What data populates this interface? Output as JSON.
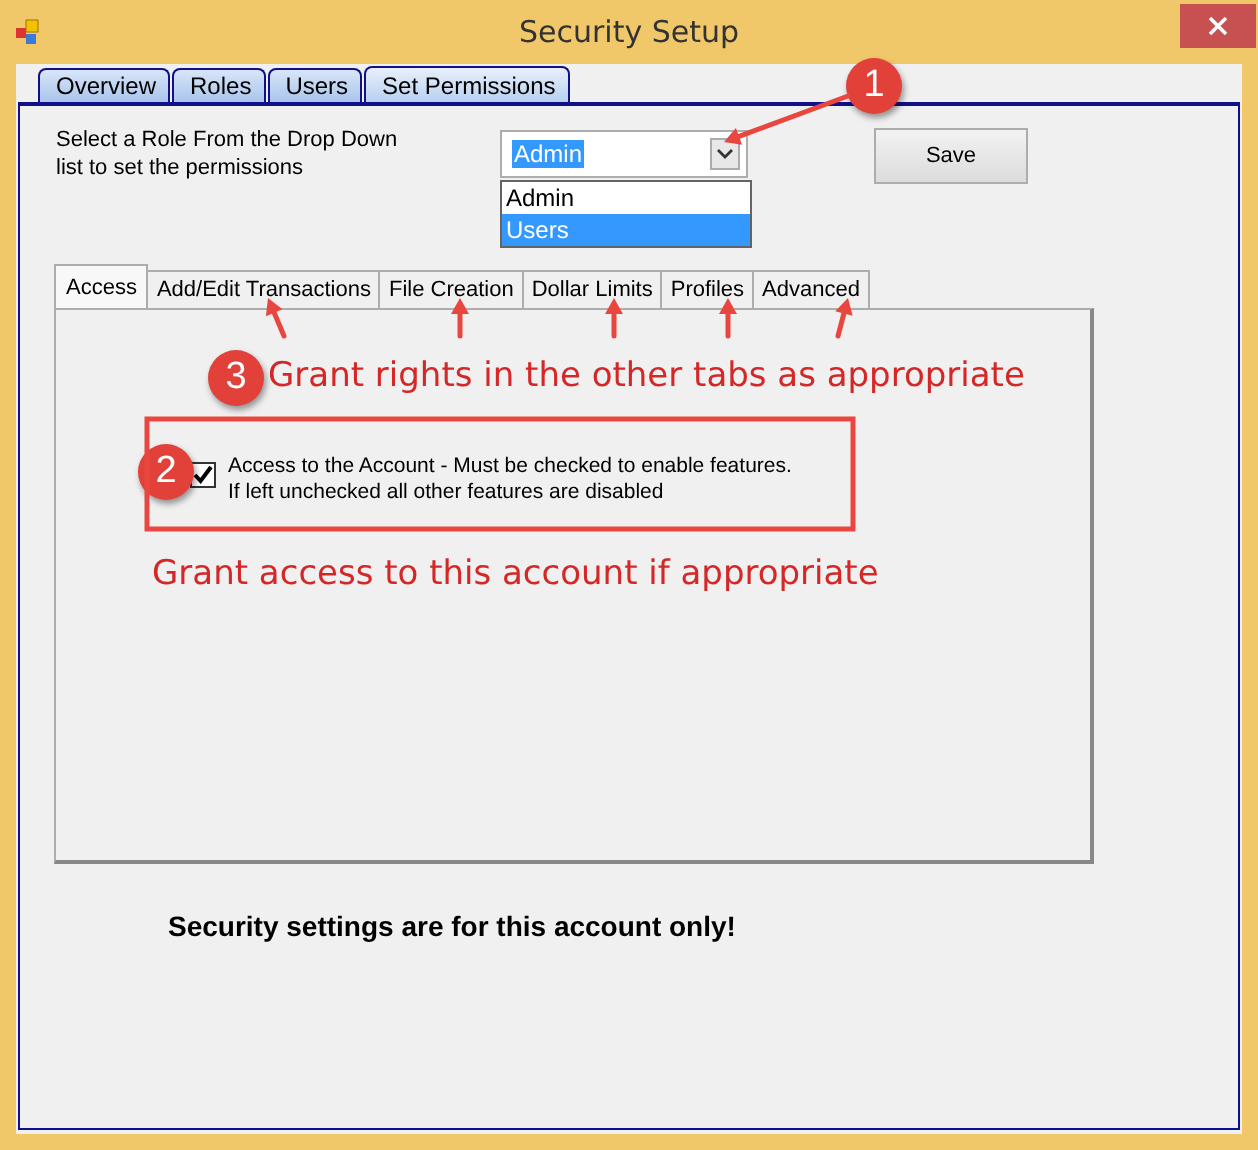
{
  "window": {
    "title": "Security Setup"
  },
  "tabs": [
    {
      "label": "Overview",
      "selected": false
    },
    {
      "label": "Roles",
      "selected": false
    },
    {
      "label": "Users",
      "selected": false
    },
    {
      "label": "Set Permissions",
      "selected": true
    }
  ],
  "role_prompt": [
    "Select a Role From the Drop Down",
    "list to set the permissions"
  ],
  "role_select": {
    "value": "Admin",
    "options": [
      {
        "label": "Admin",
        "highlighted": false
      },
      {
        "label": "Users",
        "highlighted": true
      }
    ]
  },
  "save_button": "Save",
  "permission_tabs": [
    {
      "label": "Access",
      "selected": true
    },
    {
      "label": "Add/Edit Transactions",
      "selected": false
    },
    {
      "label": "File Creation",
      "selected": false
    },
    {
      "label": "Dollar Limits",
      "selected": false
    },
    {
      "label": "Profiles",
      "selected": false
    },
    {
      "label": "Advanced",
      "selected": false
    }
  ],
  "access_checkbox": {
    "label": "Access to the Account - Must be checked to enable features.  If left unchecked all other features are disabled",
    "checked": true
  },
  "footer_note": "Security settings are for this account only!",
  "callouts": [
    {
      "number": "1"
    },
    {
      "number": "3",
      "note": "Grant rights in the other tabs as appropriate"
    },
    {
      "number": "2",
      "note": "Grant access to this account if appropriate"
    }
  ]
}
